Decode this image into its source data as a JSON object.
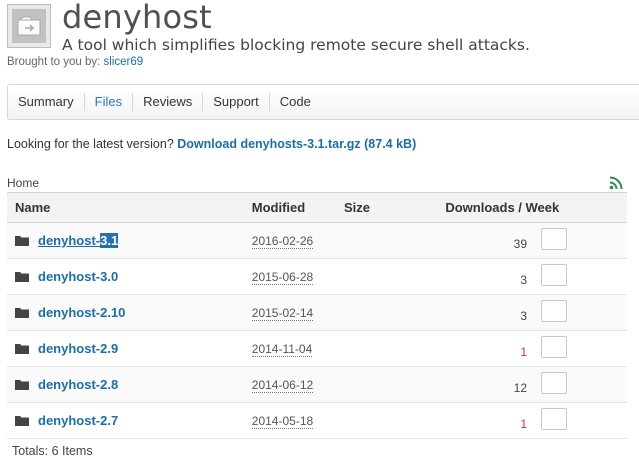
{
  "project": {
    "title": "denyhost",
    "tagline": "A tool which simplifies blocking remote secure shell attacks.",
    "brought_prefix": "Brought to you by:",
    "author": "slicer69"
  },
  "tabs": [
    {
      "label": "Summary",
      "active": false
    },
    {
      "label": "Files",
      "active": true
    },
    {
      "label": "Reviews",
      "active": false
    },
    {
      "label": "Support",
      "active": false
    },
    {
      "label": "Code",
      "active": false
    }
  ],
  "latest": {
    "prefix": "Looking for the latest version?",
    "link": "Download denyhosts-3.1.tar.gz",
    "size": "(87.4 kB)"
  },
  "breadcrumb": "Home",
  "table": {
    "headers": {
      "name": "Name",
      "modified": "Modified",
      "size": "Size",
      "downloads": "Downloads / Week"
    },
    "rows": [
      {
        "name_base": "denyhost-",
        "name_highlight": "3.1",
        "modified": "2016-02-26",
        "size": "",
        "downloads": "39",
        "downloads_red": false
      },
      {
        "name_base": "denyhost-3.0",
        "name_highlight": "",
        "modified": "2015-06-28",
        "size": "",
        "downloads": "3",
        "downloads_red": false
      },
      {
        "name_base": "denyhost-2.10",
        "name_highlight": "",
        "modified": "2015-02-14",
        "size": "",
        "downloads": "3",
        "downloads_red": false
      },
      {
        "name_base": "denyhost-2.9",
        "name_highlight": "",
        "modified": "2014-11-04",
        "size": "",
        "downloads": "1",
        "downloads_red": true
      },
      {
        "name_base": "denyhost-2.8",
        "name_highlight": "",
        "modified": "2014-06-12",
        "size": "",
        "downloads": "12",
        "downloads_red": false
      },
      {
        "name_base": "denyhost-2.7",
        "name_highlight": "",
        "modified": "2014-05-18",
        "size": "",
        "downloads": "1",
        "downloads_red": true
      }
    ]
  },
  "totals": "Totals: 6 Items",
  "colors": {
    "link": "#1c6ea4",
    "rss": "#2e8b57",
    "highlight": "#2a6fb4"
  }
}
